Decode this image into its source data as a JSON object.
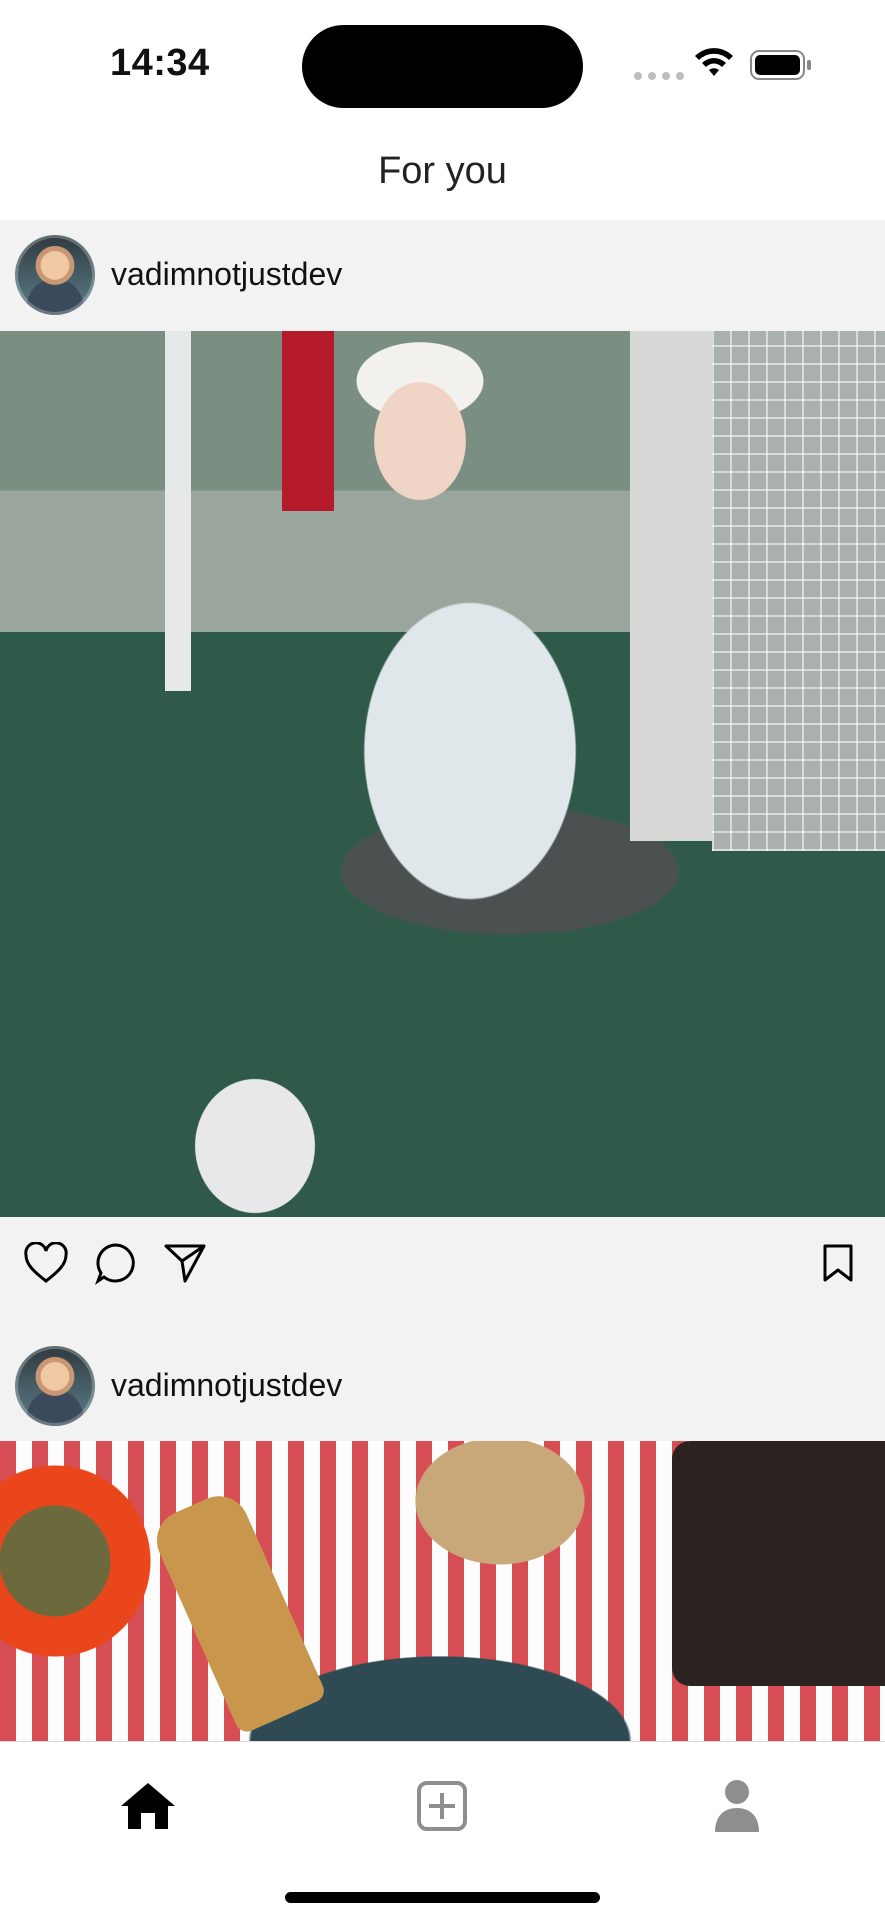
{
  "status_bar": {
    "time": "14:34",
    "icons": [
      "signal-icon",
      "wifi-icon",
      "battery-icon"
    ]
  },
  "header": {
    "title": "For you"
  },
  "posts": [
    {
      "username": "vadimnotjustdev",
      "avatar_icon": "avatar",
      "image_alt": "photo"
    },
    {
      "username": "vadimnotjustdev",
      "avatar_icon": "avatar",
      "image_alt": "photo"
    }
  ],
  "actions": {
    "like_icon": "heart-icon",
    "comment_icon": "comment-icon",
    "share_icon": "send-icon",
    "save_icon": "bookmark-icon"
  },
  "tab_bar": {
    "items": [
      "home-icon",
      "add-icon",
      "profile-icon"
    ],
    "active": "home-icon",
    "active_color": "#000000",
    "inactive_color": "#8e8e8e"
  }
}
